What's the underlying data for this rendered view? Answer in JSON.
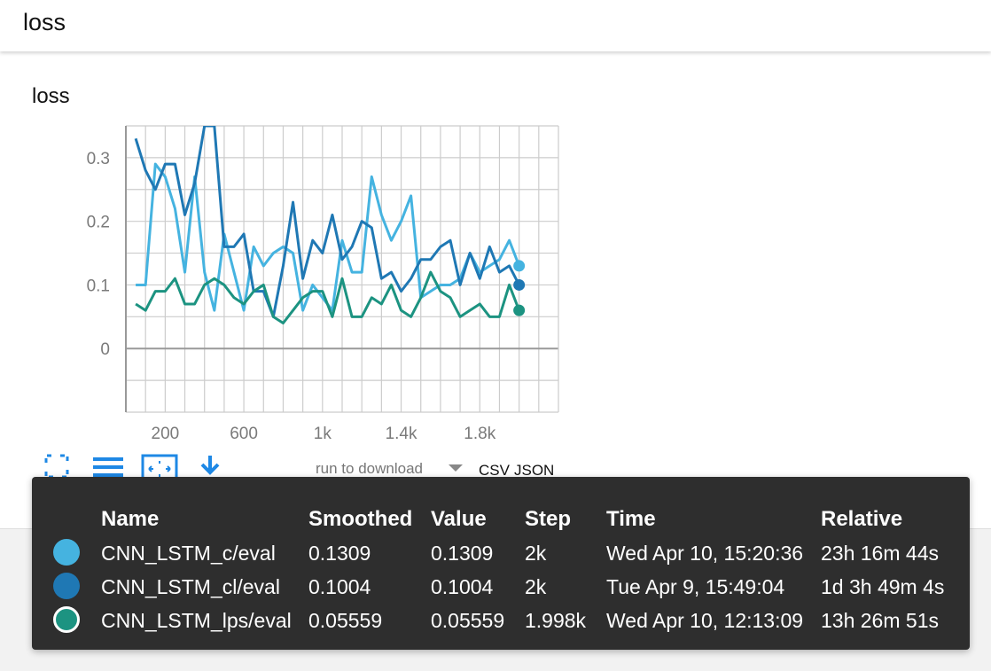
{
  "header": {
    "title": "loss"
  },
  "card": {
    "title": "loss"
  },
  "chart_data": {
    "type": "line",
    "title": "loss",
    "xlabel": "",
    "ylabel": "",
    "xlim": [
      0,
      2200
    ],
    "ylim": [
      -0.1,
      0.35
    ],
    "x_ticks": [
      200,
      600,
      1000,
      1400,
      1800
    ],
    "x_tick_labels": [
      "200",
      "600",
      "1k",
      "1.4k",
      "1.8k"
    ],
    "y_ticks": [
      0,
      0.1,
      0.2,
      0.3
    ],
    "y_tick_labels": [
      "0",
      "0.1",
      "0.2",
      "0.3"
    ],
    "grid": true,
    "legend": "tooltip table below chart",
    "series": [
      {
        "name": "CNN_LSTM_c/eval",
        "color": "#45b3e0",
        "x": [
          50,
          100,
          150,
          200,
          250,
          300,
          350,
          400,
          450,
          500,
          550,
          600,
          650,
          700,
          750,
          800,
          850,
          900,
          950,
          1000,
          1050,
          1100,
          1150,
          1200,
          1250,
          1300,
          1350,
          1400,
          1450,
          1500,
          1550,
          1600,
          1650,
          1700,
          1750,
          1800,
          1850,
          1900,
          1950,
          2000
        ],
        "y": [
          0.1,
          0.1,
          0.29,
          0.27,
          0.22,
          0.12,
          0.27,
          0.12,
          0.06,
          0.18,
          0.12,
          0.06,
          0.16,
          0.13,
          0.15,
          0.16,
          0.15,
          0.06,
          0.1,
          0.08,
          0.06,
          0.17,
          0.12,
          0.12,
          0.27,
          0.21,
          0.17,
          0.2,
          0.24,
          0.08,
          0.09,
          0.1,
          0.1,
          0.11,
          0.15,
          0.12,
          0.13,
          0.14,
          0.17,
          0.13
        ]
      },
      {
        "name": "CNN_LSTM_cl/eval",
        "color": "#1f78b4",
        "x": [
          50,
          100,
          150,
          200,
          250,
          300,
          350,
          400,
          450,
          500,
          550,
          600,
          650,
          700,
          750,
          800,
          850,
          900,
          950,
          1000,
          1050,
          1100,
          1150,
          1200,
          1250,
          1300,
          1350,
          1400,
          1450,
          1500,
          1550,
          1600,
          1650,
          1700,
          1750,
          1800,
          1850,
          1900,
          1950,
          2000
        ],
        "y": [
          0.33,
          0.28,
          0.25,
          0.29,
          0.29,
          0.21,
          0.26,
          0.35,
          0.35,
          0.16,
          0.16,
          0.18,
          0.09,
          0.09,
          0.05,
          0.13,
          0.23,
          0.11,
          0.17,
          0.15,
          0.21,
          0.14,
          0.16,
          0.2,
          0.19,
          0.11,
          0.12,
          0.09,
          0.11,
          0.14,
          0.14,
          0.16,
          0.17,
          0.1,
          0.15,
          0.11,
          0.16,
          0.12,
          0.13,
          0.1
        ]
      },
      {
        "name": "CNN_LSTM_lps/eval",
        "color": "#1c9381",
        "x": [
          50,
          100,
          150,
          200,
          250,
          300,
          350,
          400,
          450,
          500,
          550,
          600,
          650,
          700,
          750,
          800,
          850,
          900,
          950,
          1000,
          1050,
          1100,
          1150,
          1200,
          1250,
          1300,
          1350,
          1400,
          1450,
          1500,
          1550,
          1600,
          1650,
          1700,
          1750,
          1800,
          1850,
          1900,
          1950,
          2000
        ],
        "y": [
          0.07,
          0.06,
          0.09,
          0.09,
          0.11,
          0.07,
          0.07,
          0.1,
          0.11,
          0.1,
          0.08,
          0.07,
          0.09,
          0.1,
          0.05,
          0.04,
          0.06,
          0.08,
          0.09,
          0.09,
          0.05,
          0.11,
          0.05,
          0.05,
          0.08,
          0.07,
          0.1,
          0.06,
          0.05,
          0.08,
          0.12,
          0.09,
          0.08,
          0.05,
          0.06,
          0.07,
          0.05,
          0.05,
          0.1,
          0.06
        ]
      }
    ]
  },
  "toolbar": {
    "run_select_placeholder": "run to download",
    "csv_label": "CSV",
    "json_label": "JSON"
  },
  "tooltip": {
    "headers": {
      "name": "Name",
      "smoothed": "Smoothed",
      "value": "Value",
      "step": "Step",
      "time": "Time",
      "relative": "Relative"
    },
    "rows": [
      {
        "color": "#45b3e0",
        "name": "CNN_LSTM_c/eval",
        "smoothed": "0.1309",
        "value": "0.1309",
        "step": "2k",
        "time": "Wed Apr 10, 15:20:36",
        "relative": "23h 16m 44s"
      },
      {
        "color": "#1f78b4",
        "name": "CNN_LSTM_cl/eval",
        "smoothed": "0.1004",
        "value": "0.1004",
        "step": "2k",
        "time": "Tue Apr 9, 15:49:04",
        "relative": "1d 3h 49m 4s"
      },
      {
        "color": "#1c9381",
        "name": "CNN_LSTM_lps/eval",
        "smoothed": "0.05559",
        "value": "0.05559",
        "step": "1.998k",
        "time": "Wed Apr 10, 12:13:09",
        "relative": "13h 26m 51s"
      }
    ]
  },
  "colors": {
    "accent": "#1e88e5",
    "tooltip_bg": "#2e2e2e"
  }
}
